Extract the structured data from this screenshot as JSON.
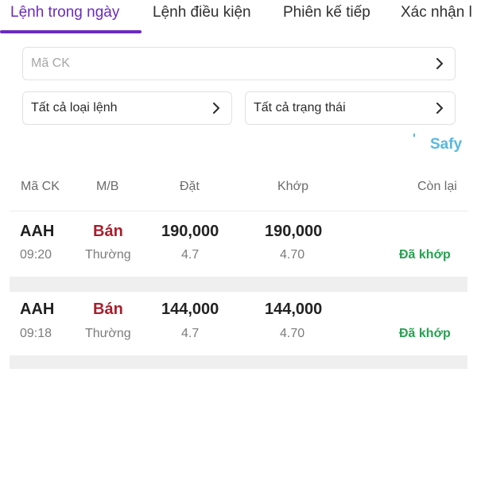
{
  "tabs": [
    {
      "label": "Lệnh trong ngày",
      "active": true
    },
    {
      "label": "Lệnh điều kiện",
      "active": false
    },
    {
      "label": "Phiên kế tiếp",
      "active": false
    },
    {
      "label": "Xác nhận l",
      "active": false
    }
  ],
  "filters": {
    "symbol_placeholder": "Mã CK",
    "order_type": "Tất cả loại lệnh",
    "status": "Tất cả trạng thái"
  },
  "brand": "Safy",
  "columns": [
    "Mã CK",
    "M/B",
    "Đặt",
    "Khớp",
    "Còn lại"
  ],
  "orders": [
    {
      "symbol": "AAH",
      "time": "09:20",
      "side": "Bán",
      "type": "Thường",
      "order_qty": "190,000",
      "order_price": "4.7",
      "match_qty": "190,000",
      "match_price": "4.70",
      "remaining": "",
      "status": "Đã khớp"
    },
    {
      "symbol": "AAH",
      "time": "09:18",
      "side": "Bán",
      "type": "Thường",
      "order_qty": "144,000",
      "order_price": "4.7",
      "match_qty": "144,000",
      "match_price": "4.70",
      "remaining": "",
      "status": "Đã khớp"
    }
  ],
  "colors": {
    "accent": "#6a2bc0",
    "sell": "#a61f2d",
    "matched": "#24a24f",
    "brand": "#58b8de"
  }
}
